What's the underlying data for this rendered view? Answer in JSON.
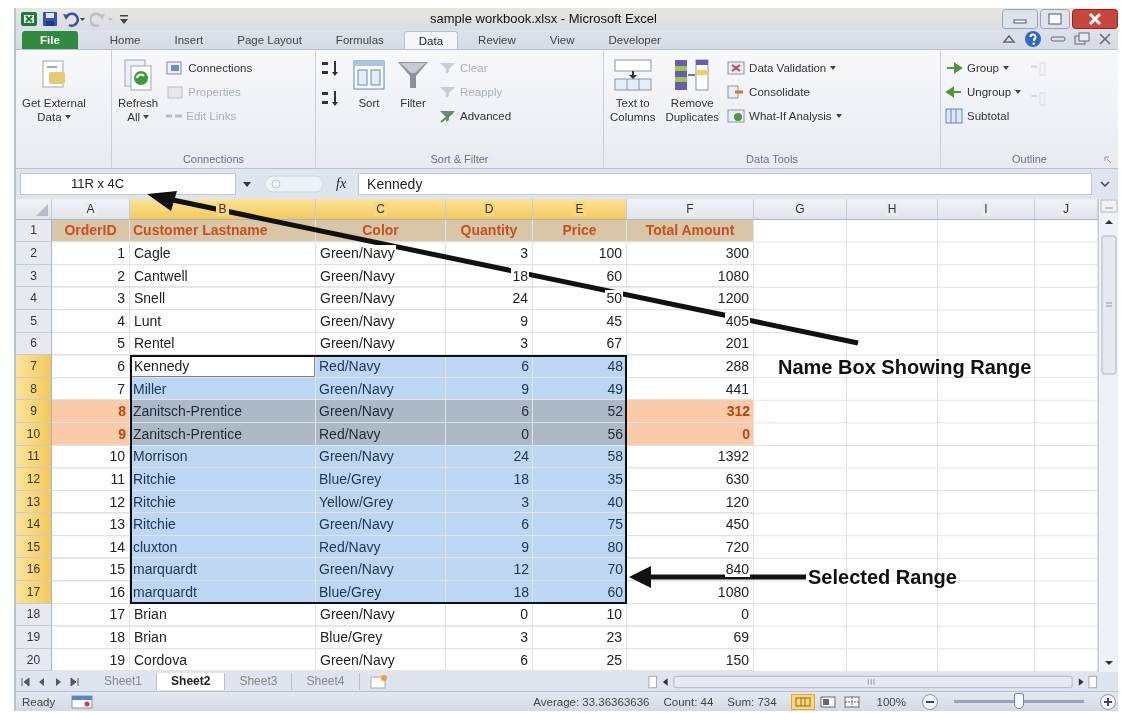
{
  "window": {
    "title": "sample workbook.xlsx - Microsoft Excel"
  },
  "ribbon_tabs": [
    {
      "label": "File",
      "kind": "file",
      "selected": false
    },
    {
      "label": "Home",
      "kind": "tab",
      "selected": false
    },
    {
      "label": "Insert",
      "kind": "tab",
      "selected": false
    },
    {
      "label": "Page Layout",
      "kind": "tab",
      "selected": false
    },
    {
      "label": "Formulas",
      "kind": "tab",
      "selected": false
    },
    {
      "label": "Data",
      "kind": "tab",
      "selected": true
    },
    {
      "label": "Review",
      "kind": "tab",
      "selected": false
    },
    {
      "label": "View",
      "kind": "tab",
      "selected": false
    },
    {
      "label": "Developer",
      "kind": "tab",
      "selected": false
    }
  ],
  "ribbon_groups": [
    {
      "items": [
        {
          "kind": "large",
          "lines": [
            "Get External",
            "Data"
          ],
          "dropdown": true,
          "disabled": false
        }
      ]
    },
    {
      "label": "Connections",
      "items": [
        {
          "kind": "large",
          "lines": [
            "Refresh",
            "All"
          ],
          "dropdown": true,
          "disabled": false
        },
        {
          "kind": "small",
          "lines": [
            "Connections"
          ],
          "dropdown": false,
          "disabled": false
        },
        {
          "kind": "small",
          "lines": [
            "Properties"
          ],
          "dropdown": false,
          "disabled": true
        },
        {
          "kind": "small",
          "lines": [
            "Edit Links"
          ],
          "dropdown": false,
          "disabled": true
        }
      ]
    },
    {
      "label": "Sort & Filter",
      "items": [
        {
          "kind": "icon",
          "disabled": false
        },
        {
          "kind": "icon",
          "disabled": false
        },
        {
          "kind": "large",
          "lines": [
            "Sort"
          ],
          "dropdown": false,
          "disabled": false
        },
        {
          "kind": "large",
          "lines": [
            "Filter"
          ],
          "dropdown": false,
          "disabled": false
        },
        {
          "kind": "small",
          "lines": [
            "Clear"
          ],
          "dropdown": false,
          "disabled": true
        },
        {
          "kind": "small",
          "lines": [
            "Reapply"
          ],
          "dropdown": false,
          "disabled": true
        },
        {
          "kind": "small",
          "lines": [
            "Advanced"
          ],
          "dropdown": false,
          "disabled": false
        }
      ]
    },
    {
      "label": "Data Tools",
      "items": [
        {
          "kind": "large",
          "lines": [
            "Text to",
            "Columns"
          ],
          "dropdown": false,
          "disabled": false
        },
        {
          "kind": "large",
          "lines": [
            "Remove",
            "Duplicates"
          ],
          "dropdown": false,
          "disabled": false
        },
        {
          "kind": "small",
          "lines": [
            "Data Validation"
          ],
          "dropdown": true,
          "disabled": false
        },
        {
          "kind": "small",
          "lines": [
            "Consolidate"
          ],
          "dropdown": false,
          "disabled": false
        },
        {
          "kind": "small",
          "lines": [
            "What-If Analysis"
          ],
          "dropdown": true,
          "disabled": false
        }
      ]
    },
    {
      "label": "Outline",
      "items": [
        {
          "kind": "small",
          "lines": [
            "Group"
          ],
          "dropdown": true,
          "disabled": false
        },
        {
          "kind": "small",
          "lines": [
            "Ungroup"
          ],
          "dropdown": true,
          "disabled": false
        },
        {
          "kind": "small",
          "lines": [
            "Subtotal"
          ],
          "dropdown": false,
          "disabled": false
        },
        {
          "kind": "icon",
          "disabled": true
        },
        {
          "kind": "icon",
          "disabled": true
        }
      ]
    }
  ],
  "formula_bar": {
    "name_box": "11R x 4C",
    "fx": "fx",
    "value": "Kennedy"
  },
  "columns": [
    {
      "label": "A",
      "selected": false
    },
    {
      "label": "B",
      "selected": true
    },
    {
      "label": "C",
      "selected": true
    },
    {
      "label": "D",
      "selected": true
    },
    {
      "label": "E",
      "selected": true
    },
    {
      "label": "F",
      "selected": false
    },
    {
      "label": "G",
      "selected": false
    },
    {
      "label": "H",
      "selected": false
    },
    {
      "label": "I",
      "selected": false
    },
    {
      "label": "J",
      "selected": false
    }
  ],
  "rows": [
    {
      "header": "1",
      "kind": "heading",
      "selected": false,
      "active": false,
      "flagged": false,
      "cells": [
        "OrderID",
        "Customer Lastname",
        "Color",
        "Quantity",
        "Price",
        "Total Amount"
      ]
    },
    {
      "header": "2",
      "kind": "data",
      "selected": false,
      "active": false,
      "flagged": false,
      "cells": [
        "1",
        "Cagle",
        "Green/Navy",
        "3",
        "100",
        "300"
      ]
    },
    {
      "header": "3",
      "kind": "data",
      "selected": false,
      "active": false,
      "flagged": false,
      "cells": [
        "2",
        "Cantwell",
        "Green/Navy",
        "18",
        "60",
        "1080"
      ]
    },
    {
      "header": "4",
      "kind": "data",
      "selected": false,
      "active": false,
      "flagged": false,
      "cells": [
        "3",
        "Snell",
        "Green/Navy",
        "24",
        "50",
        "1200"
      ]
    },
    {
      "header": "5",
      "kind": "data",
      "selected": false,
      "active": false,
      "flagged": false,
      "cells": [
        "4",
        "Lunt",
        "Green/Navy",
        "9",
        "45",
        "405"
      ]
    },
    {
      "header": "6",
      "kind": "data",
      "selected": false,
      "active": false,
      "flagged": false,
      "cells": [
        "5",
        "Rentel",
        "Green/Navy",
        "3",
        "67",
        "201"
      ]
    },
    {
      "header": "7",
      "kind": "data",
      "selected": true,
      "active": true,
      "flagged": false,
      "cells": [
        "6",
        "Kennedy",
        "Red/Navy",
        "6",
        "48",
        "288"
      ]
    },
    {
      "header": "8",
      "kind": "data",
      "selected": true,
      "active": false,
      "flagged": false,
      "cells": [
        "7",
        "Miller",
        "Green/Navy",
        "9",
        "49",
        "441"
      ]
    },
    {
      "header": "9",
      "kind": "data",
      "selected": true,
      "active": false,
      "flagged": true,
      "cells": [
        "8",
        "Zanitsch-Prentice",
        "Green/Navy",
        "6",
        "52",
        "312"
      ]
    },
    {
      "header": "10",
      "kind": "data",
      "selected": true,
      "active": false,
      "flagged": true,
      "cells": [
        "9",
        "Zanitsch-Prentice",
        "Red/Navy",
        "0",
        "56",
        "0"
      ]
    },
    {
      "header": "11",
      "kind": "data",
      "selected": true,
      "active": false,
      "flagged": false,
      "cells": [
        "10",
        "Morrison",
        "Green/Navy",
        "24",
        "58",
        "1392"
      ]
    },
    {
      "header": "12",
      "kind": "data",
      "selected": true,
      "active": false,
      "flagged": false,
      "cells": [
        "11",
        "Ritchie",
        "Blue/Grey",
        "18",
        "35",
        "630"
      ]
    },
    {
      "header": "13",
      "kind": "data",
      "selected": true,
      "active": false,
      "flagged": false,
      "cells": [
        "12",
        "Ritchie",
        "Yellow/Grey",
        "3",
        "40",
        "120"
      ]
    },
    {
      "header": "14",
      "kind": "data",
      "selected": true,
      "active": false,
      "flagged": false,
      "cells": [
        "13",
        "Ritchie",
        "Green/Navy",
        "6",
        "75",
        "450"
      ]
    },
    {
      "header": "15",
      "kind": "data",
      "selected": true,
      "active": false,
      "flagged": false,
      "cells": [
        "14",
        "cluxton",
        "Red/Navy",
        "9",
        "80",
        "720"
      ]
    },
    {
      "header": "16",
      "kind": "data",
      "selected": true,
      "active": false,
      "flagged": false,
      "cells": [
        "15",
        "marquardt",
        "Green/Navy",
        "12",
        "70",
        "840"
      ]
    },
    {
      "header": "17",
      "kind": "data",
      "selected": true,
      "active": false,
      "flagged": false,
      "cells": [
        "16",
        "marquardt",
        "Blue/Grey",
        "18",
        "60",
        "1080"
      ]
    },
    {
      "header": "18",
      "kind": "data",
      "selected": false,
      "active": false,
      "flagged": false,
      "cells": [
        "17",
        "Brian",
        "Green/Navy",
        "0",
        "10",
        "0"
      ]
    },
    {
      "header": "19",
      "kind": "data",
      "selected": false,
      "active": false,
      "flagged": false,
      "cells": [
        "18",
        "Brian",
        "Blue/Grey",
        "3",
        "23",
        "69"
      ]
    },
    {
      "header": "20",
      "kind": "data",
      "selected": false,
      "active": false,
      "flagged": false,
      "cells": [
        "19",
        "Cordova",
        "Green/Navy",
        "6",
        "25",
        "150"
      ]
    }
  ],
  "sheet_tabs": [
    {
      "label": "Sheet1",
      "selected": false
    },
    {
      "label": "Sheet2",
      "selected": true
    },
    {
      "label": "Sheet3",
      "selected": false
    },
    {
      "label": "Sheet4",
      "selected": false
    }
  ],
  "status_bar": {
    "mode": "Ready",
    "average": "Average: 33.36363636",
    "count": "Count: 44",
    "sum": "Sum: 734",
    "zoom": "100%",
    "zoom_slider": {
      "level": 0.5
    }
  },
  "annotations": [
    {
      "text": "Name Box Showing Range"
    },
    {
      "text": "Selected Range"
    }
  ]
}
